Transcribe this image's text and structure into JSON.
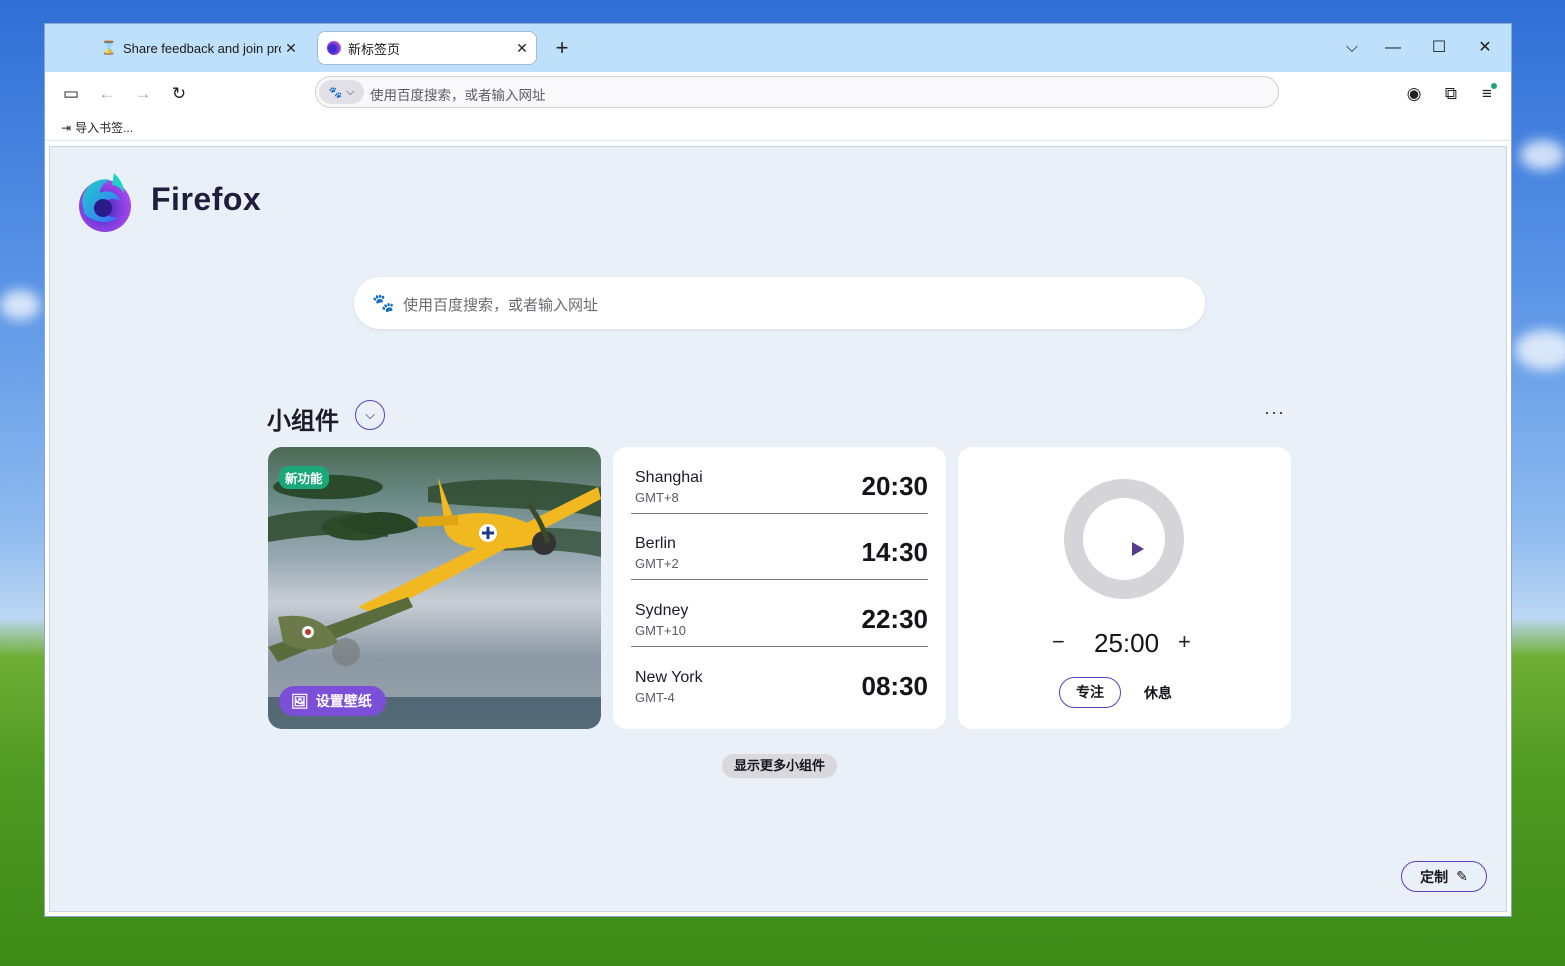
{
  "browser": {
    "tabs": [
      {
        "label": "Share feedback and join product",
        "icon": "hourglass-icon"
      },
      {
        "label": "新标签页",
        "icon": "firefox-icon",
        "active": true
      }
    ],
    "url_placeholder": "使用百度搜索，或者输入网址",
    "bookmarks_import": "导入书签..."
  },
  "page": {
    "brand": "Firefox",
    "search_placeholder": "使用百度搜索，或者输入网址",
    "widgets_title": "小组件",
    "more_menu": "···",
    "wallpaper": {
      "badge": "新功能",
      "set_label": "设置壁纸"
    },
    "clocks": [
      {
        "city": "Shanghai",
        "gmt": "GMT+8",
        "time": "20:30"
      },
      {
        "city": "Berlin",
        "gmt": "GMT+2",
        "time": "14:30"
      },
      {
        "city": "Sydney",
        "gmt": "GMT+10",
        "time": "22:30"
      },
      {
        "city": "New York",
        "gmt": "GMT-4",
        "time": "08:30"
      }
    ],
    "timer": {
      "minus": "−",
      "value": "25:00",
      "plus": "+",
      "focus": "专注",
      "break": "休息"
    },
    "show_more": "显示更多小组件",
    "customize": "定制"
  },
  "colors": {
    "accent": "#5b3fbf",
    "badge_green": "#1aa87a",
    "set_wallpaper": "#7b4fd8",
    "tabbar": "#bfe0fb",
    "newtab_bg": "#eaf0f7"
  }
}
